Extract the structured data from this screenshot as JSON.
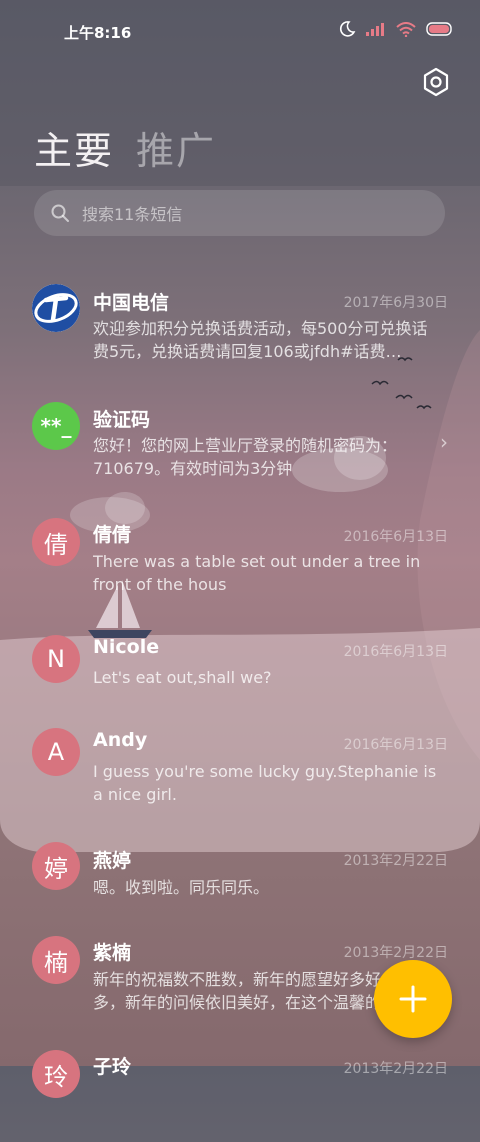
{
  "status_bar": {
    "time": "上午8:16"
  },
  "tabs": [
    {
      "label": "主要"
    },
    {
      "label": "推广"
    }
  ],
  "search": {
    "placeholder": "搜索11条短信"
  },
  "messages": [
    {
      "sender": "中国电信",
      "date": "2017年6月30日",
      "preview": "欢迎参加积分兑换话费活动，每500分可兑换话费5元，兑换话费请回复106或jfdh#话费…",
      "avatar": "china-telecom-logo"
    },
    {
      "sender": "验证码",
      "date": "",
      "preview": "您好！您的网上营业厅登录的随机密码为：710679。有效时间为3分钟",
      "avatar_text": "**_"
    },
    {
      "sender": "倩倩",
      "date": "2016年6月13日",
      "preview": "There was a table set out under a tree in front of the hous",
      "avatar_text": "倩"
    },
    {
      "sender": "Nicole",
      "date": "2016年6月13日",
      "preview": "Let's eat out,shall we?",
      "avatar_text": "N"
    },
    {
      "sender": "Andy",
      "date": "2016年6月13日",
      "preview": "I guess you're some lucky guy.Stephanie is a nice girl.",
      "avatar_text": "A"
    },
    {
      "sender": "燕婷",
      "date": "2013年2月22日",
      "preview": "嗯。收到啦。同乐同乐。",
      "avatar_text": "婷"
    },
    {
      "sender": "紫楠",
      "date": "2013年2月22日",
      "preview": "新年的祝福数不胜数，新年的愿望好多好多，新年的问候依旧美好，在这个温馨的",
      "avatar_text": "楠"
    },
    {
      "sender": "子玲",
      "date": "2013年2月22日",
      "preview": "",
      "avatar_text": "玲"
    }
  ],
  "colors": {
    "accent_fab": "#ffbf00",
    "avatar": "#d7747f",
    "verify_avatar": "#5cc84a",
    "telecom_blue": "#1f4ea3"
  }
}
